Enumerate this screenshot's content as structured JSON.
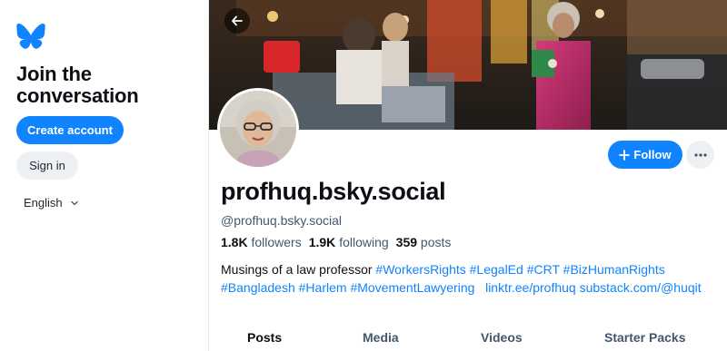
{
  "sidebar": {
    "logo_icon": "butterfly-icon",
    "heading_line1": "Join the",
    "heading_line2": "conversation",
    "create_account": "Create account",
    "sign_in": "Sign in",
    "language": "English"
  },
  "profile": {
    "display_name": "profhuq.bsky.social",
    "handle": "@profhuq.bsky.social",
    "followers_count": "1.8K",
    "followers_label": "followers",
    "following_count": "1.9K",
    "following_label": "following",
    "posts_count": "359",
    "posts_label": "posts",
    "follow_button": "Follow",
    "bio_text": "Musings of a law professor",
    "bio_tags": [
      "#WorkersRights",
      "#LegalEd",
      "#CRT",
      "#BizHumanRights",
      "#Bangladesh",
      "#Harlem",
      "#MovementLawyering"
    ],
    "bio_link1": "linktr.ee/profhuq",
    "bio_link2": "substack.com/@huqit"
  },
  "tabs": [
    "Posts",
    "Media",
    "Videos",
    "Starter Packs"
  ],
  "colors": {
    "accent": "#1083fe",
    "muted_text": "#42576c",
    "button_gray": "#eef1f4"
  }
}
